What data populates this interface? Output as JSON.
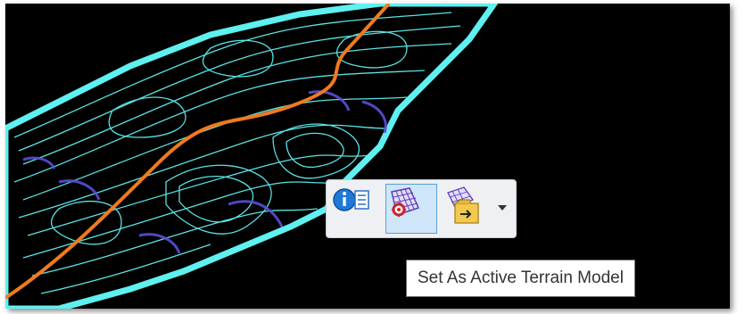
{
  "canvas": {
    "background": "#000000",
    "contour_color": "#5ff0f0",
    "contour_alt_color": "#5a4fd8",
    "road_color": "#f07a1e"
  },
  "toolbar": {
    "buttons": [
      {
        "name": "info-icon",
        "active": false
      },
      {
        "name": "set-active-terrain-icon",
        "active": true
      },
      {
        "name": "terrain-model-menu-icon",
        "active": false,
        "has_dropdown": true
      }
    ]
  },
  "tooltip": {
    "text": "Set As Active Terrain Model"
  }
}
